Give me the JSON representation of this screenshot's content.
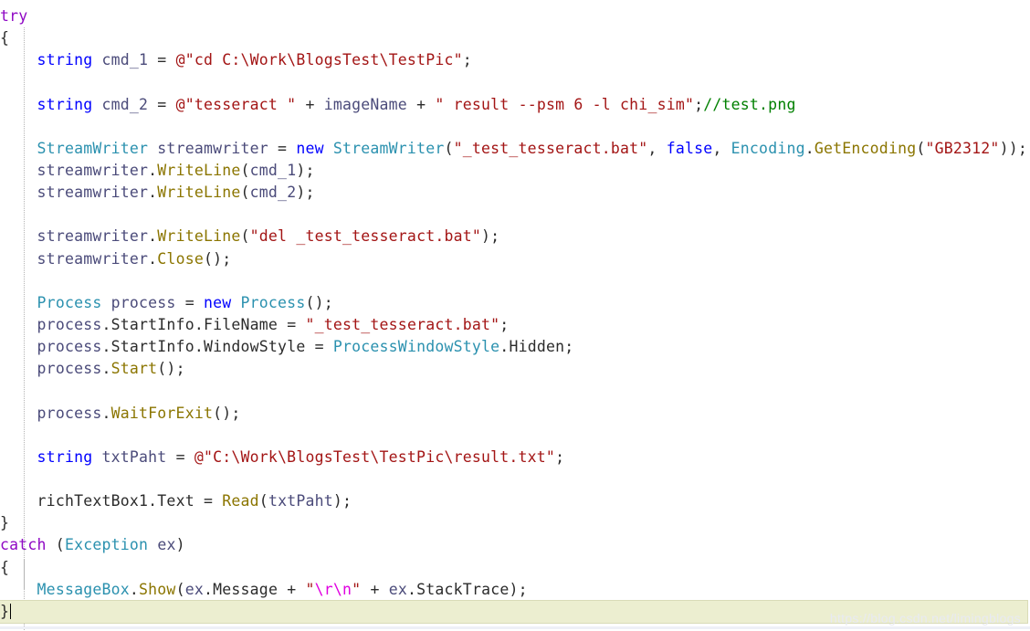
{
  "editor": {
    "language": "csharp",
    "colors": {
      "background": "#ffffff",
      "text": "#2b2b2b",
      "keyword": "#0000ff",
      "control_keyword": "#8f08c4",
      "type": "#2b91af",
      "string": "#a31515",
      "escape": "#e000e0",
      "comment": "#008000",
      "identifier": "#4b4b7a",
      "method": "#8b7500",
      "brace_highlight": "#eceed0",
      "indent_guide": "#b4b4b4",
      "watermark": "#e8eaf2"
    },
    "watermark": "https://blog.csdn.net/limingblogs",
    "caret_line": 27
  },
  "code": {
    "lines": [
      {
        "n": 1,
        "tokens": [
          {
            "t": "try",
            "c": "kwctl"
          }
        ]
      },
      {
        "n": 2,
        "tokens": [
          {
            "t": "{",
            "c": "plain"
          }
        ]
      },
      {
        "n": 3,
        "tokens": [
          {
            "t": "    ",
            "c": "plain"
          },
          {
            "t": "string",
            "c": "kw"
          },
          {
            "t": " ",
            "c": "plain"
          },
          {
            "t": "cmd_1",
            "c": "id"
          },
          {
            "t": " = ",
            "c": "plain"
          },
          {
            "t": "@\"cd C:\\Work\\BlogsTest\\TestPic\"",
            "c": "str"
          },
          {
            "t": ";",
            "c": "plain"
          }
        ]
      },
      {
        "n": 4,
        "tokens": []
      },
      {
        "n": 5,
        "tokens": [
          {
            "t": "    ",
            "c": "plain"
          },
          {
            "t": "string",
            "c": "kw"
          },
          {
            "t": " ",
            "c": "plain"
          },
          {
            "t": "cmd_2",
            "c": "id"
          },
          {
            "t": " = ",
            "c": "plain"
          },
          {
            "t": "@\"tesseract \"",
            "c": "str"
          },
          {
            "t": " + ",
            "c": "plain"
          },
          {
            "t": "imageName",
            "c": "id"
          },
          {
            "t": " + ",
            "c": "plain"
          },
          {
            "t": "\" result --psm 6 -l chi_sim\"",
            "c": "str"
          },
          {
            "t": ";",
            "c": "plain"
          },
          {
            "t": "//test.png",
            "c": "cmt"
          }
        ]
      },
      {
        "n": 6,
        "tokens": []
      },
      {
        "n": 7,
        "tokens": [
          {
            "t": "    ",
            "c": "plain"
          },
          {
            "t": "StreamWriter",
            "c": "type"
          },
          {
            "t": " ",
            "c": "plain"
          },
          {
            "t": "streamwriter",
            "c": "id"
          },
          {
            "t": " = ",
            "c": "plain"
          },
          {
            "t": "new",
            "c": "kw"
          },
          {
            "t": " ",
            "c": "plain"
          },
          {
            "t": "StreamWriter",
            "c": "type"
          },
          {
            "t": "(",
            "c": "plain"
          },
          {
            "t": "\"_test_tesseract.bat\"",
            "c": "str"
          },
          {
            "t": ", ",
            "c": "plain"
          },
          {
            "t": "false",
            "c": "kw"
          },
          {
            "t": ", ",
            "c": "plain"
          },
          {
            "t": "Encoding",
            "c": "type"
          },
          {
            "t": ".",
            "c": "plain"
          },
          {
            "t": "GetEncoding",
            "c": "meth"
          },
          {
            "t": "(",
            "c": "plain"
          },
          {
            "t": "\"GB2312\"",
            "c": "str"
          },
          {
            "t": "));",
            "c": "plain"
          }
        ]
      },
      {
        "n": 8,
        "tokens": [
          {
            "t": "    ",
            "c": "plain"
          },
          {
            "t": "streamwriter",
            "c": "id"
          },
          {
            "t": ".",
            "c": "plain"
          },
          {
            "t": "WriteLine",
            "c": "meth"
          },
          {
            "t": "(",
            "c": "plain"
          },
          {
            "t": "cmd_1",
            "c": "id"
          },
          {
            "t": ");",
            "c": "plain"
          }
        ]
      },
      {
        "n": 9,
        "tokens": [
          {
            "t": "    ",
            "c": "plain"
          },
          {
            "t": "streamwriter",
            "c": "id"
          },
          {
            "t": ".",
            "c": "plain"
          },
          {
            "t": "WriteLine",
            "c": "meth"
          },
          {
            "t": "(",
            "c": "plain"
          },
          {
            "t": "cmd_2",
            "c": "id"
          },
          {
            "t": ");",
            "c": "plain"
          }
        ]
      },
      {
        "n": 10,
        "tokens": []
      },
      {
        "n": 11,
        "tokens": [
          {
            "t": "    ",
            "c": "plain"
          },
          {
            "t": "streamwriter",
            "c": "id"
          },
          {
            "t": ".",
            "c": "plain"
          },
          {
            "t": "WriteLine",
            "c": "meth"
          },
          {
            "t": "(",
            "c": "plain"
          },
          {
            "t": "\"del _test_tesseract.bat\"",
            "c": "str"
          },
          {
            "t": ");",
            "c": "plain"
          }
        ]
      },
      {
        "n": 12,
        "tokens": [
          {
            "t": "    ",
            "c": "plain"
          },
          {
            "t": "streamwriter",
            "c": "id"
          },
          {
            "t": ".",
            "c": "plain"
          },
          {
            "t": "Close",
            "c": "meth"
          },
          {
            "t": "();",
            "c": "plain"
          }
        ]
      },
      {
        "n": 13,
        "tokens": []
      },
      {
        "n": 14,
        "tokens": [
          {
            "t": "    ",
            "c": "plain"
          },
          {
            "t": "Process",
            "c": "type"
          },
          {
            "t": " ",
            "c": "plain"
          },
          {
            "t": "process",
            "c": "id"
          },
          {
            "t": " = ",
            "c": "plain"
          },
          {
            "t": "new",
            "c": "kw"
          },
          {
            "t": " ",
            "c": "plain"
          },
          {
            "t": "Process",
            "c": "type"
          },
          {
            "t": "();",
            "c": "plain"
          }
        ]
      },
      {
        "n": 15,
        "tokens": [
          {
            "t": "    ",
            "c": "plain"
          },
          {
            "t": "process",
            "c": "id"
          },
          {
            "t": ".",
            "c": "plain"
          },
          {
            "t": "StartInfo",
            "c": "plain"
          },
          {
            "t": ".",
            "c": "plain"
          },
          {
            "t": "FileName",
            "c": "plain"
          },
          {
            "t": " = ",
            "c": "plain"
          },
          {
            "t": "\"_test_tesseract.bat\"",
            "c": "str"
          },
          {
            "t": ";",
            "c": "plain"
          }
        ]
      },
      {
        "n": 16,
        "tokens": [
          {
            "t": "    ",
            "c": "plain"
          },
          {
            "t": "process",
            "c": "id"
          },
          {
            "t": ".",
            "c": "plain"
          },
          {
            "t": "StartInfo",
            "c": "plain"
          },
          {
            "t": ".",
            "c": "plain"
          },
          {
            "t": "WindowStyle",
            "c": "plain"
          },
          {
            "t": " = ",
            "c": "plain"
          },
          {
            "t": "ProcessWindowStyle",
            "c": "type"
          },
          {
            "t": ".",
            "c": "plain"
          },
          {
            "t": "Hidden",
            "c": "plain"
          },
          {
            "t": ";",
            "c": "plain"
          }
        ]
      },
      {
        "n": 17,
        "tokens": [
          {
            "t": "    ",
            "c": "plain"
          },
          {
            "t": "process",
            "c": "id"
          },
          {
            "t": ".",
            "c": "plain"
          },
          {
            "t": "Start",
            "c": "meth"
          },
          {
            "t": "();",
            "c": "plain"
          }
        ]
      },
      {
        "n": 18,
        "tokens": []
      },
      {
        "n": 19,
        "tokens": [
          {
            "t": "    ",
            "c": "plain"
          },
          {
            "t": "process",
            "c": "id"
          },
          {
            "t": ".",
            "c": "plain"
          },
          {
            "t": "WaitForExit",
            "c": "meth"
          },
          {
            "t": "();",
            "c": "plain"
          }
        ]
      },
      {
        "n": 20,
        "tokens": []
      },
      {
        "n": 21,
        "tokens": [
          {
            "t": "    ",
            "c": "plain"
          },
          {
            "t": "string",
            "c": "kw"
          },
          {
            "t": " ",
            "c": "plain"
          },
          {
            "t": "txtPaht",
            "c": "id"
          },
          {
            "t": " = ",
            "c": "plain"
          },
          {
            "t": "@\"C:\\Work\\BlogsTest\\TestPic\\result.txt\"",
            "c": "str"
          },
          {
            "t": ";",
            "c": "plain"
          }
        ]
      },
      {
        "n": 22,
        "tokens": []
      },
      {
        "n": 23,
        "tokens": [
          {
            "t": "    ",
            "c": "plain"
          },
          {
            "t": "richTextBox1",
            "c": "plain"
          },
          {
            "t": ".",
            "c": "plain"
          },
          {
            "t": "Text",
            "c": "plain"
          },
          {
            "t": " = ",
            "c": "plain"
          },
          {
            "t": "Read",
            "c": "meth"
          },
          {
            "t": "(",
            "c": "plain"
          },
          {
            "t": "txtPaht",
            "c": "id"
          },
          {
            "t": ");",
            "c": "plain"
          }
        ]
      },
      {
        "n": 24,
        "tokens": [
          {
            "t": "}",
            "c": "plain"
          }
        ]
      },
      {
        "n": 25,
        "tokens": [
          {
            "t": "catch",
            "c": "kwctl"
          },
          {
            "t": " (",
            "c": "plain"
          },
          {
            "t": "Exception",
            "c": "type"
          },
          {
            "t": " ",
            "c": "plain"
          },
          {
            "t": "ex",
            "c": "id"
          },
          {
            "t": ")",
            "c": "plain"
          }
        ]
      },
      {
        "n": 26,
        "tokens": [
          {
            "t": "{",
            "c": "plain"
          }
        ]
      },
      {
        "n": 27,
        "tokens": [
          {
            "t": "    ",
            "c": "plain"
          },
          {
            "t": "MessageBox",
            "c": "type"
          },
          {
            "t": ".",
            "c": "plain"
          },
          {
            "t": "Show",
            "c": "meth"
          },
          {
            "t": "(",
            "c": "plain"
          },
          {
            "t": "ex",
            "c": "id"
          },
          {
            "t": ".",
            "c": "plain"
          },
          {
            "t": "Message",
            "c": "plain"
          },
          {
            "t": " + ",
            "c": "plain"
          },
          {
            "t": "\"",
            "c": "str"
          },
          {
            "t": "\\r\\n",
            "c": "esc"
          },
          {
            "t": "\"",
            "c": "str"
          },
          {
            "t": " + ",
            "c": "plain"
          },
          {
            "t": "ex",
            "c": "id"
          },
          {
            "t": ".",
            "c": "plain"
          },
          {
            "t": "StackTrace",
            "c": "plain"
          },
          {
            "t": ");",
            "c": "plain"
          }
        ]
      },
      {
        "n": 28,
        "highlight": true,
        "caret": true,
        "tokens": [
          {
            "t": "}",
            "c": "plain"
          }
        ]
      }
    ]
  }
}
